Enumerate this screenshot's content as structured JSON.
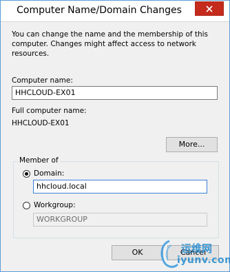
{
  "window": {
    "title": "Computer Name/Domain Changes",
    "close_label": "close"
  },
  "description": "You can change the name and the membership of this computer. Changes might affect access to network resources.",
  "computer_name": {
    "label": "Computer name:",
    "value": "HHCLOUD-EX01"
  },
  "full_computer_name": {
    "label": "Full computer name:",
    "value": "HHCLOUD-EX01"
  },
  "more_button": "More...",
  "member_of": {
    "title": "Member of",
    "domain": {
      "label": "Domain:",
      "value": "hhcloud.local",
      "selected": true
    },
    "workgroup": {
      "label": "Workgroup:",
      "value": "WORKGROUP",
      "selected": false
    }
  },
  "buttons": {
    "ok": "OK",
    "cancel": "Cancel"
  },
  "watermark": {
    "cn": "运维网",
    "en": "iyunv.com"
  },
  "colors": {
    "close_bg": "#c42b1c",
    "window_border": "#5b9bd5",
    "focus_border": "#3a7fd6"
  }
}
